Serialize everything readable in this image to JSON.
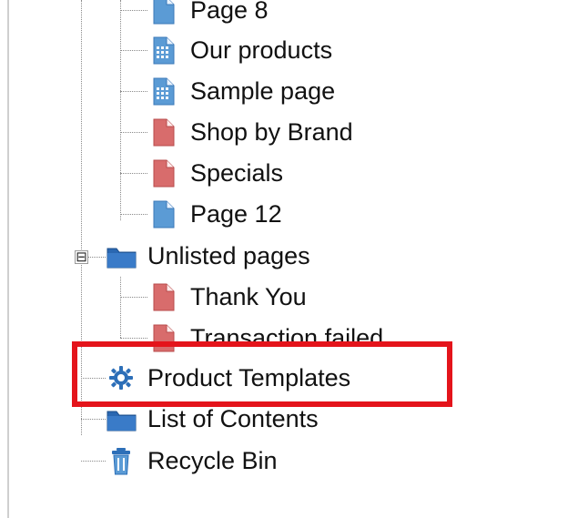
{
  "tree": {
    "items": [
      {
        "label": "Page 8",
        "icon": "page-blue-icon"
      },
      {
        "label": "Our products",
        "icon": "page-grid-blue-icon"
      },
      {
        "label": "Sample page",
        "icon": "page-grid-blue-icon"
      },
      {
        "label": "Shop by Brand",
        "icon": "page-red-icon"
      },
      {
        "label": "Specials",
        "icon": "page-red-icon"
      },
      {
        "label": "Page 12",
        "icon": "page-blue-icon"
      },
      {
        "label": "Unlisted pages",
        "icon": "folder-blue-icon",
        "expander": "⊟"
      },
      {
        "label": "Thank You",
        "icon": "page-red-icon"
      },
      {
        "label": "Transaction failed",
        "icon": "page-red-icon"
      },
      {
        "label": "Product Templates",
        "icon": "gear-icon"
      },
      {
        "label": "List of Contents",
        "icon": "folder-blue-icon"
      },
      {
        "label": "Recycle Bin",
        "icon": "trash-icon"
      }
    ]
  },
  "colors": {
    "accent_blue": "#5b9bd5",
    "page_red": "#d86c6c",
    "highlight_red": "#e4141b"
  }
}
